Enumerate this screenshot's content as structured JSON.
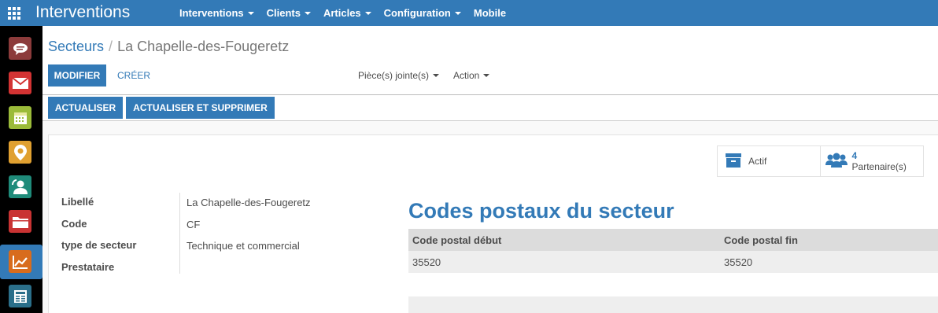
{
  "colors": {
    "brand": "#337ab7",
    "appbar": "#000000"
  },
  "topbar": {
    "brand": "Interventions",
    "menu": [
      {
        "label": "Interventions",
        "dropdown": true
      },
      {
        "label": "Clients",
        "dropdown": true
      },
      {
        "label": "Articles",
        "dropdown": true
      },
      {
        "label": "Configuration",
        "dropdown": true
      },
      {
        "label": "Mobile",
        "dropdown": false
      }
    ]
  },
  "appbar": {
    "apps": [
      {
        "name": "discuss-icon",
        "color": "#8c3b3b"
      },
      {
        "name": "mail-icon",
        "color": "#d33333"
      },
      {
        "name": "calendar-icon",
        "color": "#9bbb3a"
      },
      {
        "name": "location-icon",
        "color": "#e0a030"
      },
      {
        "name": "contacts-icon",
        "color": "#1f8b7a"
      },
      {
        "name": "folder-icon",
        "color": "#c93333"
      },
      {
        "name": "reporting-icon",
        "color": "#d86c1d",
        "active": true
      },
      {
        "name": "newspaper-icon",
        "color": "#2b6f8a"
      }
    ]
  },
  "breadcrumb": {
    "parent": "Secteurs",
    "separator": "/",
    "current": "La Chapelle-des-Fougeretz"
  },
  "controls": {
    "edit": "Modifier",
    "create": "Créer",
    "attachments": "Pièce(s) jointe(s)",
    "action": "Action"
  },
  "header_buttons": {
    "refresh": "Actualiser",
    "refresh_delete": "Actualiser et supprimer"
  },
  "stat_buttons": {
    "active": {
      "label": "Actif",
      "icon": "archive-icon"
    },
    "partners": {
      "value": "4",
      "label": "Partenaire(s)",
      "icon": "users-icon"
    }
  },
  "fields": [
    {
      "label": "Libellé",
      "value": "La Chapelle-des-Fougeretz"
    },
    {
      "label": "Code",
      "value": "CF"
    },
    {
      "label": "type de secteur",
      "value": "Technique et commercial"
    },
    {
      "label": "Prestataire",
      "value": ""
    }
  ],
  "postal_codes": {
    "title": "Codes postaux du secteur",
    "columns": [
      "Code postal début",
      "Code postal fin"
    ],
    "rows": [
      [
        "35520",
        "35520"
      ]
    ]
  }
}
